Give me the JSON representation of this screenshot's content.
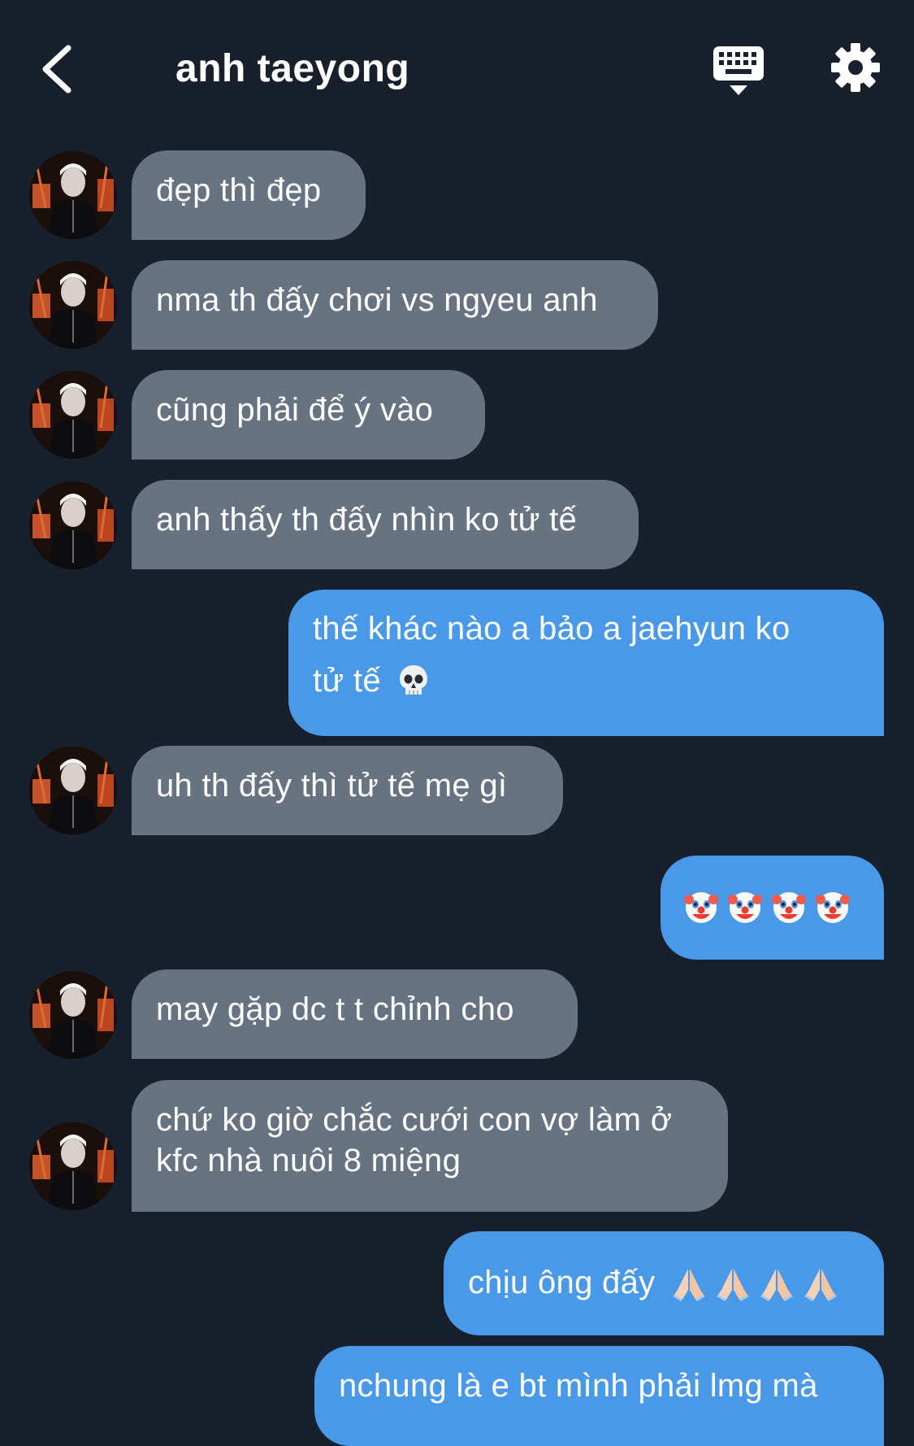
{
  "header": {
    "title": "anh taeyong",
    "back_icon": "chevron-left-icon",
    "keyboard_icon": "keyboard-icon",
    "settings_icon": "gear-icon"
  },
  "colors": {
    "background": "#18202b",
    "incoming_bubble": "#677381",
    "outgoing_bubble": "#4a98e8",
    "text": "#ffffff"
  },
  "messages": [
    {
      "direction": "incoming",
      "text": "đẹp thì đẹp"
    },
    {
      "direction": "incoming",
      "text": "nma th đấy chơi vs ngyeu anh"
    },
    {
      "direction": "incoming",
      "text": "cũng phải để ý vào"
    },
    {
      "direction": "incoming",
      "text": "anh thấy th đấy nhìn ko tử tế"
    },
    {
      "direction": "outgoing",
      "text_line1": "thế khác nào a bảo a jaehyun ko",
      "text_line2": "tử tế",
      "emoji": "skull-emoji"
    },
    {
      "direction": "incoming",
      "text": "uh th đấy thì tử tế mẹ gì"
    },
    {
      "direction": "outgoing",
      "emoji": "clown-face-emoji",
      "emoji_count": 4
    },
    {
      "direction": "incoming",
      "text": "may gặp dc t t chỉnh cho"
    },
    {
      "direction": "incoming",
      "text_line1": "chứ ko giờ chắc cưới con vợ làm ở",
      "text_line2": "kfc nhà nuôi 8 miệng"
    },
    {
      "direction": "outgoing",
      "text": "chịu ông đấy",
      "emoji": "folded-hands-emoji",
      "emoji_count": 4
    },
    {
      "direction": "outgoing",
      "text": "nchung là e bt mình phải lmg mà"
    }
  ]
}
